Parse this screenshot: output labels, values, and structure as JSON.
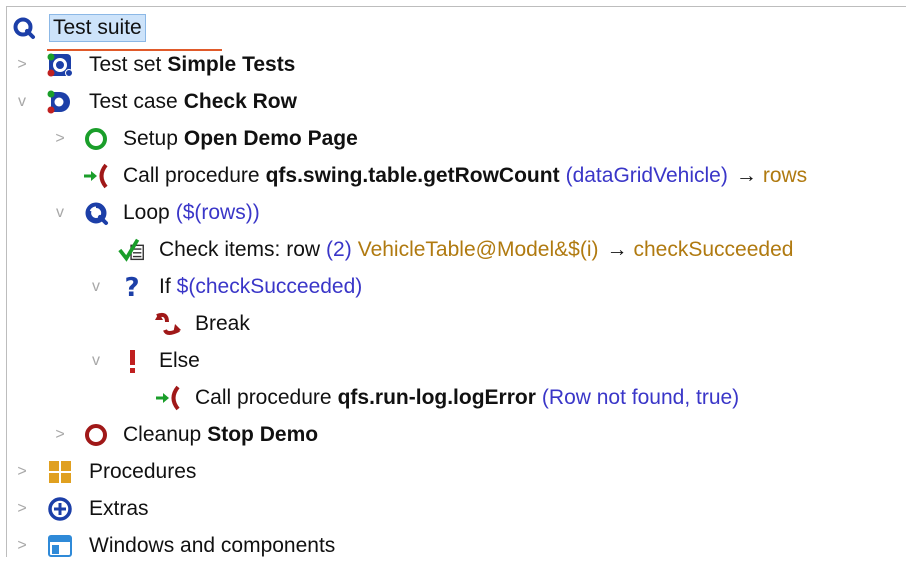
{
  "tree": {
    "root": {
      "label": "Test suite"
    },
    "test_set": {
      "type_label": "Test set",
      "name": "Simple Tests"
    },
    "test_case": {
      "type_label": "Test case",
      "name": "Check Row"
    },
    "setup": {
      "type_label": "Setup",
      "name": "Open Demo Page"
    },
    "call1": {
      "type_label": "Call procedure",
      "name": "qfs.swing.table.getRowCount",
      "params": "(dataGridVehicle)",
      "arrow": "→",
      "result": "rows"
    },
    "loop": {
      "type_label": "Loop",
      "params": "($(rows))"
    },
    "check": {
      "type_label": "Check items: row",
      "index": "(2)",
      "target": "VehicleTable@Model&$(i)",
      "arrow": "→",
      "result": "checkSucceeded"
    },
    "if_node": {
      "type_label": "If",
      "condition": "$(checkSucceeded)"
    },
    "break_node": {
      "type_label": "Break"
    },
    "else_node": {
      "type_label": "Else"
    },
    "call2": {
      "type_label": "Call procedure",
      "name": "qfs.run-log.logError",
      "params": "(Row not found, true)"
    },
    "cleanup": {
      "type_label": "Cleanup",
      "name": "Stop Demo"
    },
    "procedures": {
      "label": "Procedures"
    },
    "extras": {
      "label": "Extras"
    },
    "windows": {
      "label": "Windows and components"
    }
  },
  "toggles": {
    "collapsed": ">",
    "expanded": "v"
  },
  "colors": {
    "selection": "#cde3fa",
    "param_blue": "#3a36c8",
    "variable_gold": "#b07a10",
    "procedure_green": "#1a9e2a",
    "cleanup_red": "#a01818",
    "qf_blue": "#1c3fa8"
  },
  "icons": {
    "root": "qftest-suite-icon",
    "test_set": "test-set-icon",
    "test_case": "test-case-icon",
    "setup": "setup-icon",
    "call": "procedure-call-icon",
    "loop": "loop-icon",
    "check": "check-items-icon",
    "if": "if-icon",
    "break": "break-icon",
    "else": "else-icon",
    "cleanup": "cleanup-icon",
    "procedures": "procedures-icon",
    "extras": "extras-icon",
    "windows": "windows-components-icon"
  }
}
